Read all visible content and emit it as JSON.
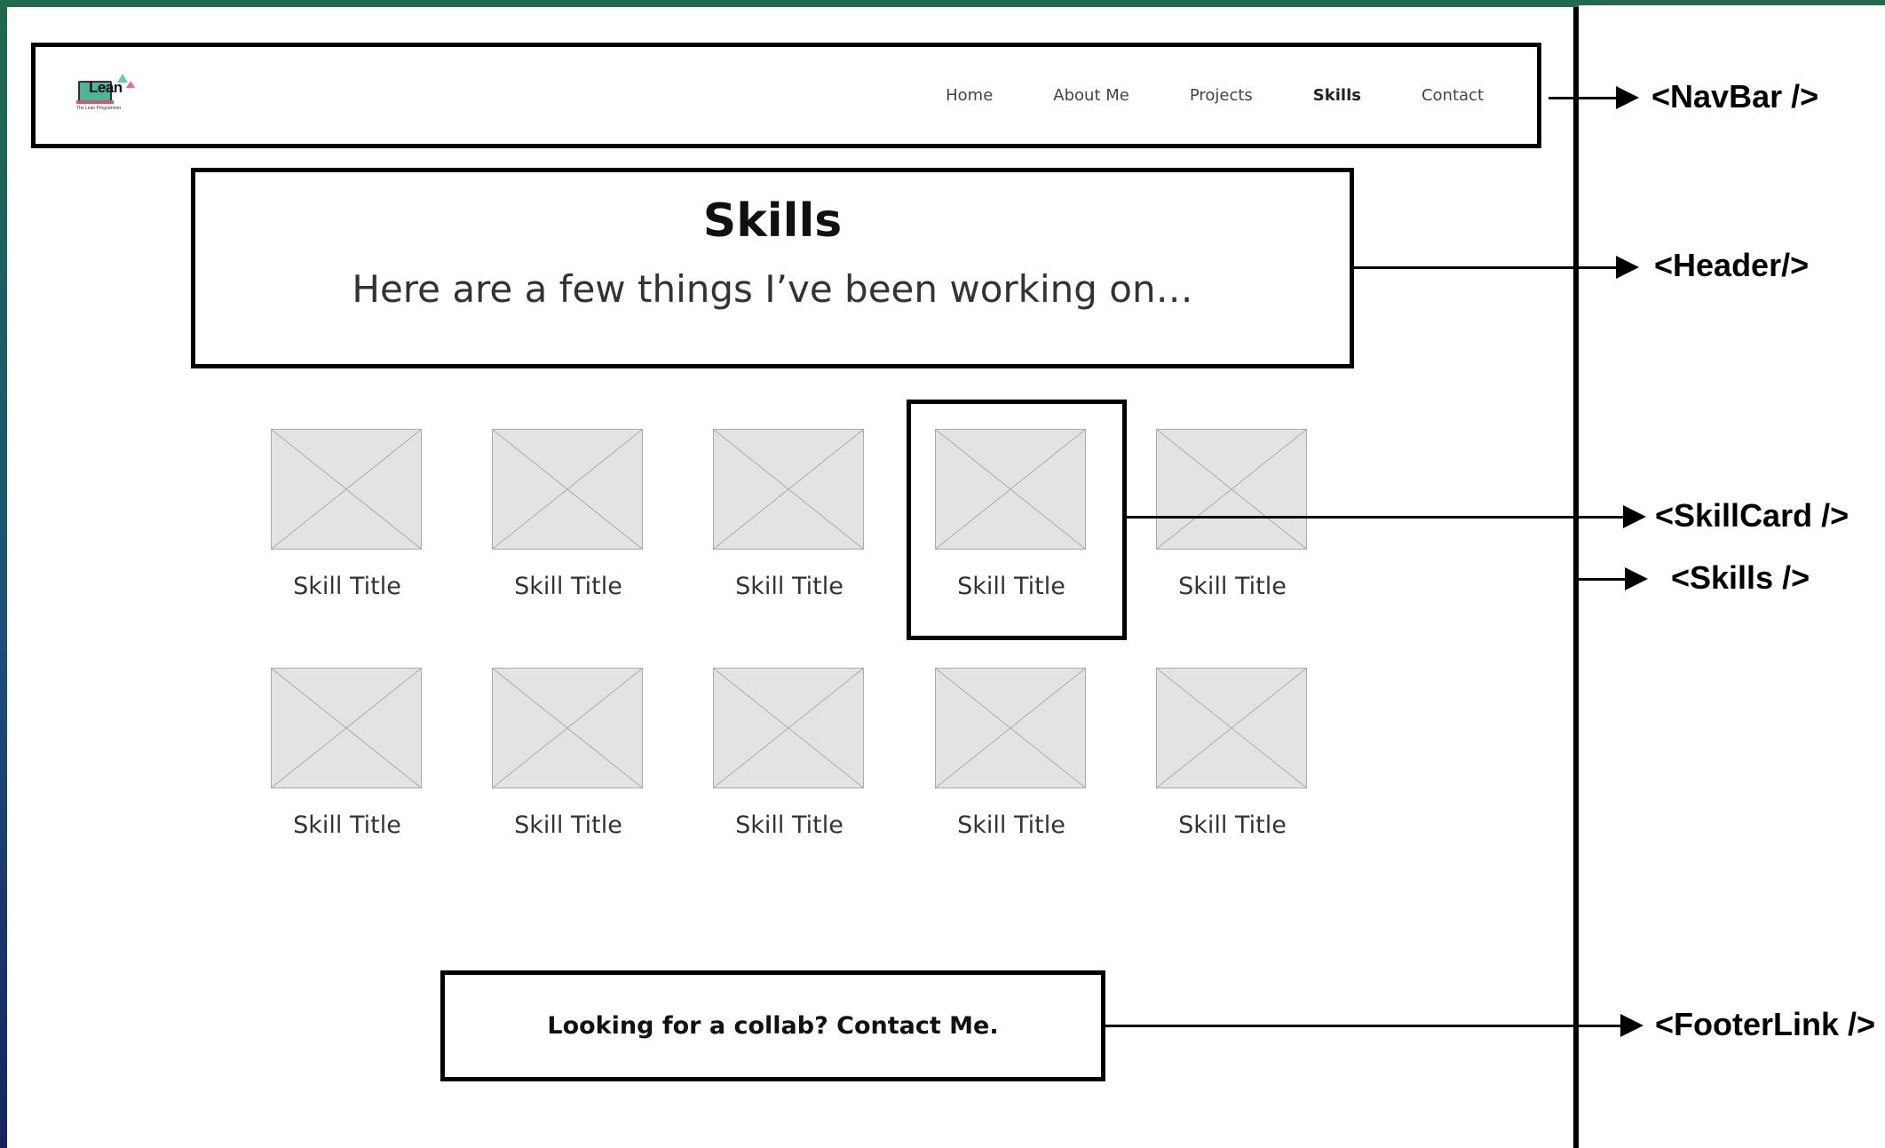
{
  "navbar": {
    "logo_word": "Lean",
    "logo_tagline": "The Lean Programmer",
    "links": [
      {
        "label": "Home"
      },
      {
        "label": "About Me"
      },
      {
        "label": "Projects"
      },
      {
        "label": "Skills"
      },
      {
        "label": "Contact"
      }
    ],
    "active_link": "Skills"
  },
  "header": {
    "title": "Skills",
    "subtitle": "Here are a few things I’ve been working on…"
  },
  "skills": [
    {
      "title": "Skill Title"
    },
    {
      "title": "Skill Title"
    },
    {
      "title": "Skill Title"
    },
    {
      "title": "Skill Title"
    },
    {
      "title": "Skill Title"
    },
    {
      "title": "Skill Title"
    },
    {
      "title": "Skill Title"
    },
    {
      "title": "Skill Title"
    },
    {
      "title": "Skill Title"
    },
    {
      "title": "Skill Title"
    }
  ],
  "footer": {
    "link_text": "Looking for a collab? Contact Me."
  },
  "annotations": {
    "navbar": "<NavBar />",
    "header": "<Header/>",
    "skillcard": "<SkillCard />",
    "skills": "<Skills />",
    "footerlink": "<FooterLink />"
  },
  "colors": {
    "frame_gradient_top": "#1f6b4e",
    "frame_gradient_bottom": "#16245f",
    "placeholder_fill": "#e3e3e3",
    "logo_teal": "#4fb39b",
    "logo_pink": "#e56c9a"
  }
}
